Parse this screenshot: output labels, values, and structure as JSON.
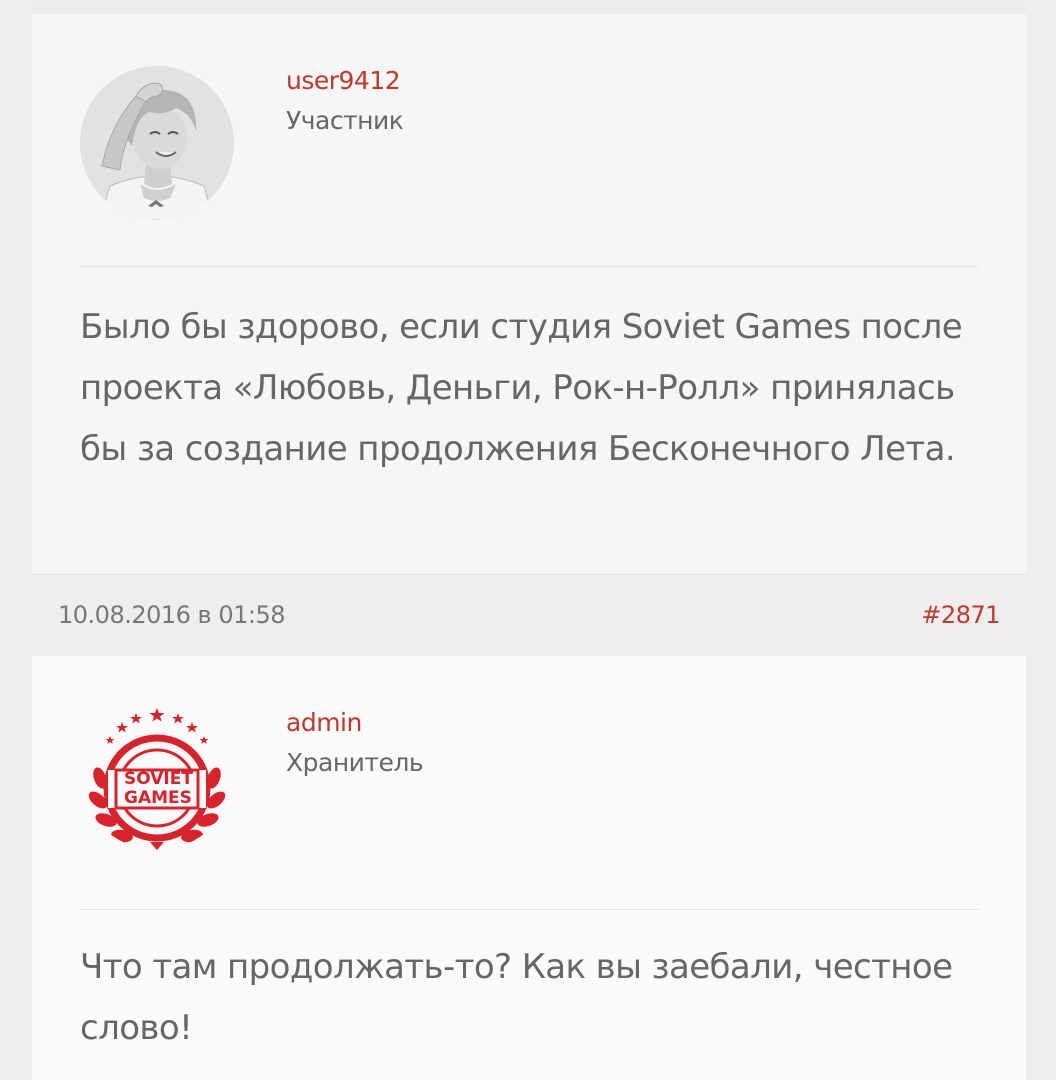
{
  "posts": [
    {
      "username": "user9412",
      "role": "Участник",
      "text": "Было бы здорово, если студия Soviet Games после проекта «Любовь, Деньги, Рок-н-Ролл» принялась бы за создание продолжения Бесконечного Лета."
    },
    {
      "username": "admin",
      "role": "Хранитель",
      "text": "Что там продолжать-то? Как вы заебали, честное слово!"
    }
  ],
  "post_meta": {
    "date": "10.08.2016 в 01:58",
    "number": "#2871"
  },
  "logo": {
    "line1": "SOVIET",
    "line2": "GAMES"
  },
  "colors": {
    "accent": "#c0392b",
    "logo_red": "#d8232a",
    "text": "#666666",
    "meta": "#777777",
    "background": "#eeeeee"
  },
  "icons": {
    "avatar_user": "anime-girl-avatar-icon",
    "avatar_admin": "soviet-games-logo-icon"
  }
}
